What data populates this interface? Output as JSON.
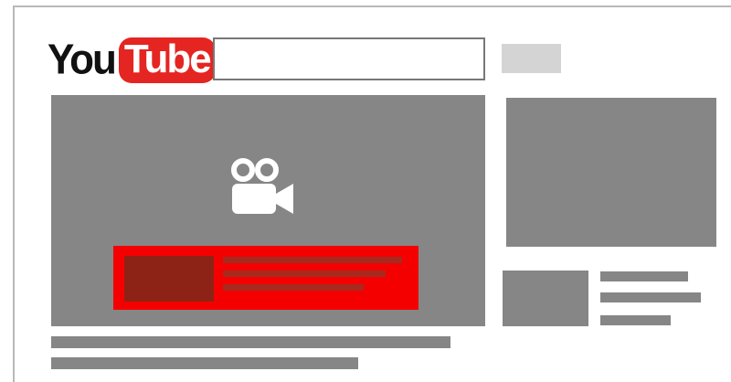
{
  "logo": {
    "part1": "You",
    "part2": "Tube"
  },
  "search": {
    "value": "",
    "placeholder": ""
  },
  "colors": {
    "brand_red": "#e52521",
    "overlay_red": "#f40000",
    "overlay_dark": "#8c2316",
    "placeholder_gray": "#868686"
  },
  "icons": {
    "player_icon": "video-camera-icon"
  }
}
